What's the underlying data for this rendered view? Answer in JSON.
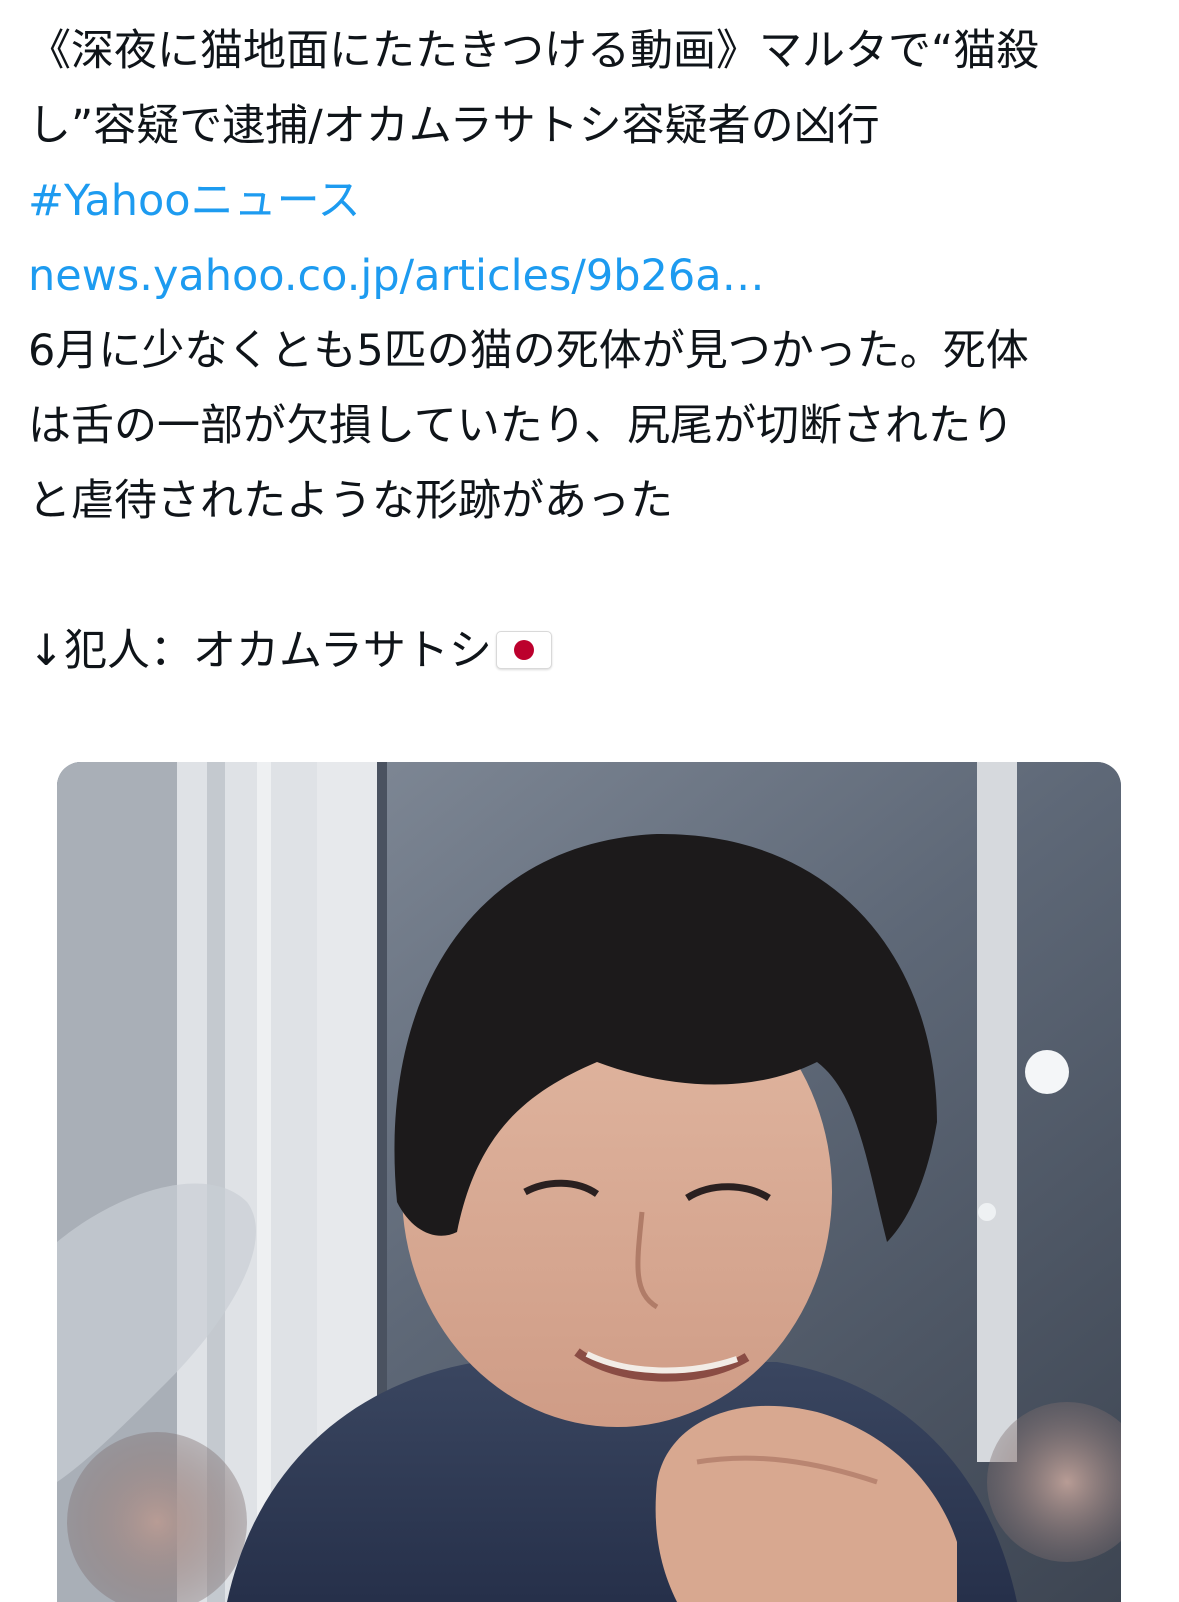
{
  "tweet": {
    "line1": "《深夜に猫地面にたたきつける動画》マルタで“猫殺",
    "line2": "し”容疑で逮捕/オカムラサトシ容疑者の凶行",
    "hashtag": "#Yahooニュース",
    "link": "news.yahoo.co.jp/articles/9b26a…",
    "body_line1": "6月に少なくとも5匹の猫の死体が見つかった。死体",
    "body_line2": "は舌の一部が欠損していたり、尻尾が切断されたり",
    "body_line3": "と虐待されたような形跡があった",
    "culprit": "↓犯人：オカムラサトシ",
    "flag_icon": "japan-flag-emoji"
  },
  "media": {
    "type": "photo",
    "icon": "photo-of-person"
  },
  "colors": {
    "link": "#1d9bf0",
    "text": "#0f1419",
    "flag_red": "#bc002d"
  }
}
